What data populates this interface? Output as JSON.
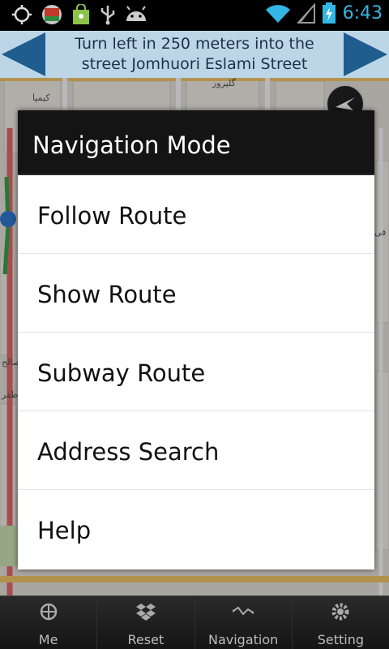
{
  "status_bar": {
    "time": "6:43",
    "icons": [
      "gps-icon",
      "app-icon",
      "shopping-bag-icon",
      "usb-icon",
      "android-icon",
      "wifi-icon",
      "signal-icon",
      "battery-icon"
    ]
  },
  "banner": {
    "line1": "Turn left in 250 meters into the",
    "line2": "street Jomhuori Eslami Street",
    "background": "#bcd6e8",
    "arrow_color": "#1f5d8f"
  },
  "dialog": {
    "title": "Navigation Mode",
    "items": [
      {
        "label": "Follow Route"
      },
      {
        "label": "Show Route"
      },
      {
        "label": "Subway Route"
      },
      {
        "label": "Address Search"
      },
      {
        "label": "Help"
      }
    ]
  },
  "bottom_nav": {
    "items": [
      {
        "label": "Me",
        "icon": "crosshair-icon"
      },
      {
        "label": "Reset",
        "icon": "dropbox-icon"
      },
      {
        "label": "Navigation",
        "icon": "route-icon"
      },
      {
        "label": "Setting",
        "icon": "gear-icon"
      }
    ]
  },
  "map": {
    "street_labels": [
      "گلپرور",
      "كيمپا",
      "صالح",
      "ظفر",
      "فی"
    ]
  }
}
